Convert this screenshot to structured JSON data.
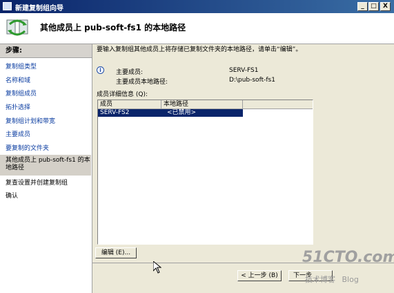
{
  "window": {
    "title": "新建复制组向导",
    "buttons": {
      "minimize": "_",
      "maximize": "□",
      "close": "X"
    }
  },
  "header": {
    "title": "其他成员上 pub-soft-fs1 的本地路径",
    "icon": "replication-wizard-icon"
  },
  "sidebar": {
    "heading": "步骤:",
    "steps": [
      {
        "label": "复制组类型",
        "state": "done"
      },
      {
        "label": "名称和域",
        "state": "done"
      },
      {
        "label": "复制组成员",
        "state": "done"
      },
      {
        "label": "拓扑选择",
        "state": "done"
      },
      {
        "label": "复制组计划和带宽",
        "state": "done"
      },
      {
        "label": "主要成员",
        "state": "done"
      },
      {
        "label": "要复制的文件夹",
        "state": "done"
      },
      {
        "label": "其他成员上 pub-soft-fs1 的本地路径",
        "state": "current"
      },
      {
        "label": "复查设置并创建复制组",
        "state": "pending"
      },
      {
        "label": "确认",
        "state": "pending"
      }
    ]
  },
  "content": {
    "description": "要输入复制组其他成员上将存储已复制文件夹的本地路径，请单击“编辑”。",
    "primary_member_label": "主要成员:",
    "primary_member_value": "SERV-FS1",
    "primary_path_label": "主要成员本地路径:",
    "primary_path_value": "D:\\pub-soft-fs1",
    "details_label": "成员详细信息 (Q):",
    "table": {
      "columns": [
        "成员",
        "本地路径"
      ],
      "rows": [
        {
          "member": "SERV-FS2",
          "path": "<已禁用>",
          "selected": true
        }
      ]
    },
    "edit_button": "编辑 (E)..."
  },
  "footer": {
    "back_button": "< 上一步 (B)",
    "next_button": "下一步"
  },
  "watermark": {
    "site": "51CTO.com",
    "subtitle": "技术博客",
    "blog": "Blog"
  }
}
